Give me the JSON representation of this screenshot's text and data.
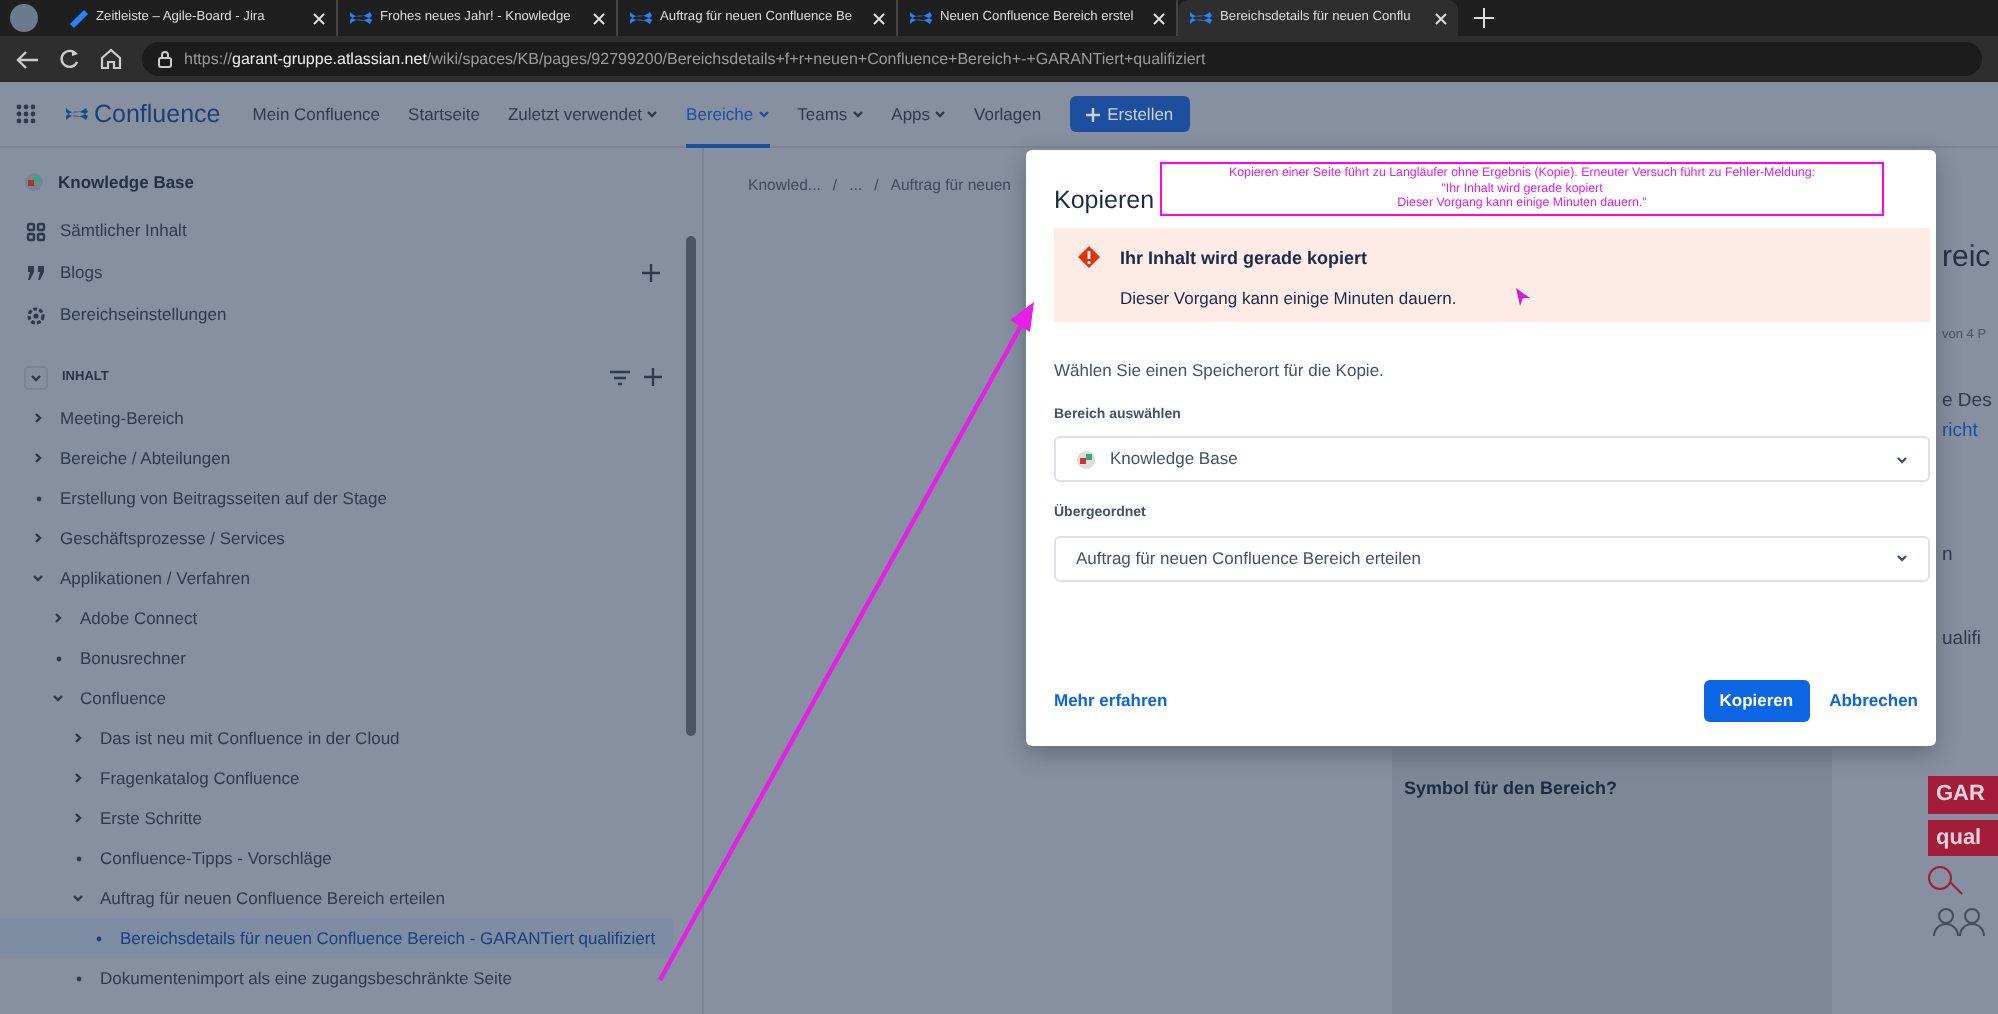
{
  "browser": {
    "tabs": [
      {
        "title": "Zeitleiste – Agile-Board - Jira",
        "kind": "jira",
        "selected": false
      },
      {
        "title": "Frohes neues Jahr! - Knowledge",
        "kind": "confluence",
        "selected": false
      },
      {
        "title": "Auftrag für neuen Confluence Be",
        "kind": "confluence",
        "selected": false
      },
      {
        "title": "Neuen Confluence Bereich erstel",
        "kind": "confluence",
        "selected": false
      },
      {
        "title": "Bereichsdetails für neuen Conflu",
        "kind": "confluence",
        "selected": true
      }
    ],
    "address_bar": {
      "scheme": "https://",
      "host": "garant-gruppe.atlassian.net",
      "path": "/wiki/spaces/KB/pages/92799200/Bereichsdetails+f+r+neuen+Confluence+Bereich+-+GARANTiert+qualifiziert"
    }
  },
  "top_nav": {
    "product": "Confluence",
    "items": [
      {
        "label": "Mein Confluence",
        "dropdown": false,
        "selected": false
      },
      {
        "label": "Startseite",
        "dropdown": false,
        "selected": false
      },
      {
        "label": "Zuletzt verwendet",
        "dropdown": true,
        "selected": false
      },
      {
        "label": "Bereiche",
        "dropdown": true,
        "selected": true
      },
      {
        "label": "Teams",
        "dropdown": true,
        "selected": false
      },
      {
        "label": "Apps",
        "dropdown": true,
        "selected": false
      },
      {
        "label": "Vorlagen",
        "dropdown": false,
        "selected": false
      }
    ],
    "create_button": "Erstellen"
  },
  "sidebar": {
    "space_name": "Knowledge Base",
    "links": [
      {
        "label": "Sämtlicher Inhalt",
        "add": false
      },
      {
        "label": "Blogs",
        "add": true
      },
      {
        "label": "Bereichseinstellungen",
        "add": false
      }
    ],
    "section_title": "INHALT",
    "tree": [
      {
        "label": "Meeting-Bereich",
        "kind": "branch",
        "expanded": false,
        "selected": false
      },
      {
        "label": "Bereiche / Abteilungen",
        "kind": "branch",
        "expanded": false,
        "selected": false
      },
      {
        "label": "Erstellung von Beitragsseiten auf der Stage",
        "kind": "leaf",
        "selected": false
      },
      {
        "label": "Geschäftsprozesse / Services",
        "kind": "branch",
        "expanded": false,
        "selected": false
      },
      {
        "label": "Applikationen / Verfahren",
        "kind": "branch",
        "expanded": true,
        "selected": false,
        "children": [
          {
            "label": "Adobe Connect",
            "kind": "branch",
            "expanded": false,
            "selected": false
          },
          {
            "label": "Bonusrechner",
            "kind": "leaf",
            "selected": false
          },
          {
            "label": "Confluence",
            "kind": "branch",
            "expanded": true,
            "selected": false,
            "children": [
              {
                "label": "Das ist neu mit Confluence in der Cloud",
                "kind": "branch",
                "expanded": false,
                "selected": false
              },
              {
                "label": "Fragenkatalog Confluence",
                "kind": "branch",
                "expanded": false,
                "selected": false
              },
              {
                "label": "Erste Schritte",
                "kind": "branch",
                "expanded": false,
                "selected": false
              },
              {
                "label": "Confluence-Tipps - Vorschläge",
                "kind": "leaf",
                "selected": false
              },
              {
                "label": "Auftrag für neuen Confluence Bereich erteilen",
                "kind": "branch",
                "expanded": true,
                "selected": false,
                "children": [
                  {
                    "label": "Bereichsdetails für neuen Confluence Bereich - GARANTiert qualifiziert",
                    "kind": "leaf",
                    "selected": true
                  }
                ]
              },
              {
                "label": "Dokumentenimport als eine zugangsbeschränkte Seite",
                "kind": "leaf",
                "selected": false
              }
            ]
          }
        ]
      }
    ]
  },
  "content": {
    "breadcrumb": [
      "Knowled...",
      "/",
      "...",
      "/",
      "Auftrag für neuen"
    ],
    "fragments": [
      {
        "text": "reic",
        "kind": "heading"
      },
      {
        "text": "von 4 P",
        "kind": "meta"
      },
      {
        "text": "e Des",
        "kind": "text"
      },
      {
        "text": "richt",
        "kind": "link"
      },
      {
        "text": "n",
        "kind": "text"
      },
      {
        "text": "ualifi",
        "kind": "text"
      }
    ],
    "table_cell": "Symbol für den Bereich?",
    "logo_text": [
      "GAR",
      "qual"
    ]
  },
  "dialog": {
    "title": "Kopieren",
    "alert": {
      "title": "Ihr Inhalt wird gerade kopiert",
      "message": "Dieser Vorgang kann einige Minuten dauern."
    },
    "intro": "Wählen Sie einen Speicherort für die Kopie.",
    "fields": [
      {
        "label": "Bereich auswählen",
        "value": "Knowledge Base",
        "kind": "space"
      },
      {
        "label": "Übergeordnet",
        "value": "Auftrag für neuen Confluence Bereich erteilen",
        "kind": "page"
      }
    ],
    "learn_more": "Mehr erfahren",
    "primary_button": "Kopieren",
    "cancel_button": "Abbrechen"
  },
  "annotation": {
    "lines": [
      "Kopieren einer Seite führt zu Langläufer ohne Ergebnis (Kopie). Erneuter Versuch führt zu Fehler-Meldung:",
      "\"Ihr Inhalt wird gerade kopiert",
      "Dieser Vorgang kann einige Minuten dauern.\""
    ]
  }
}
